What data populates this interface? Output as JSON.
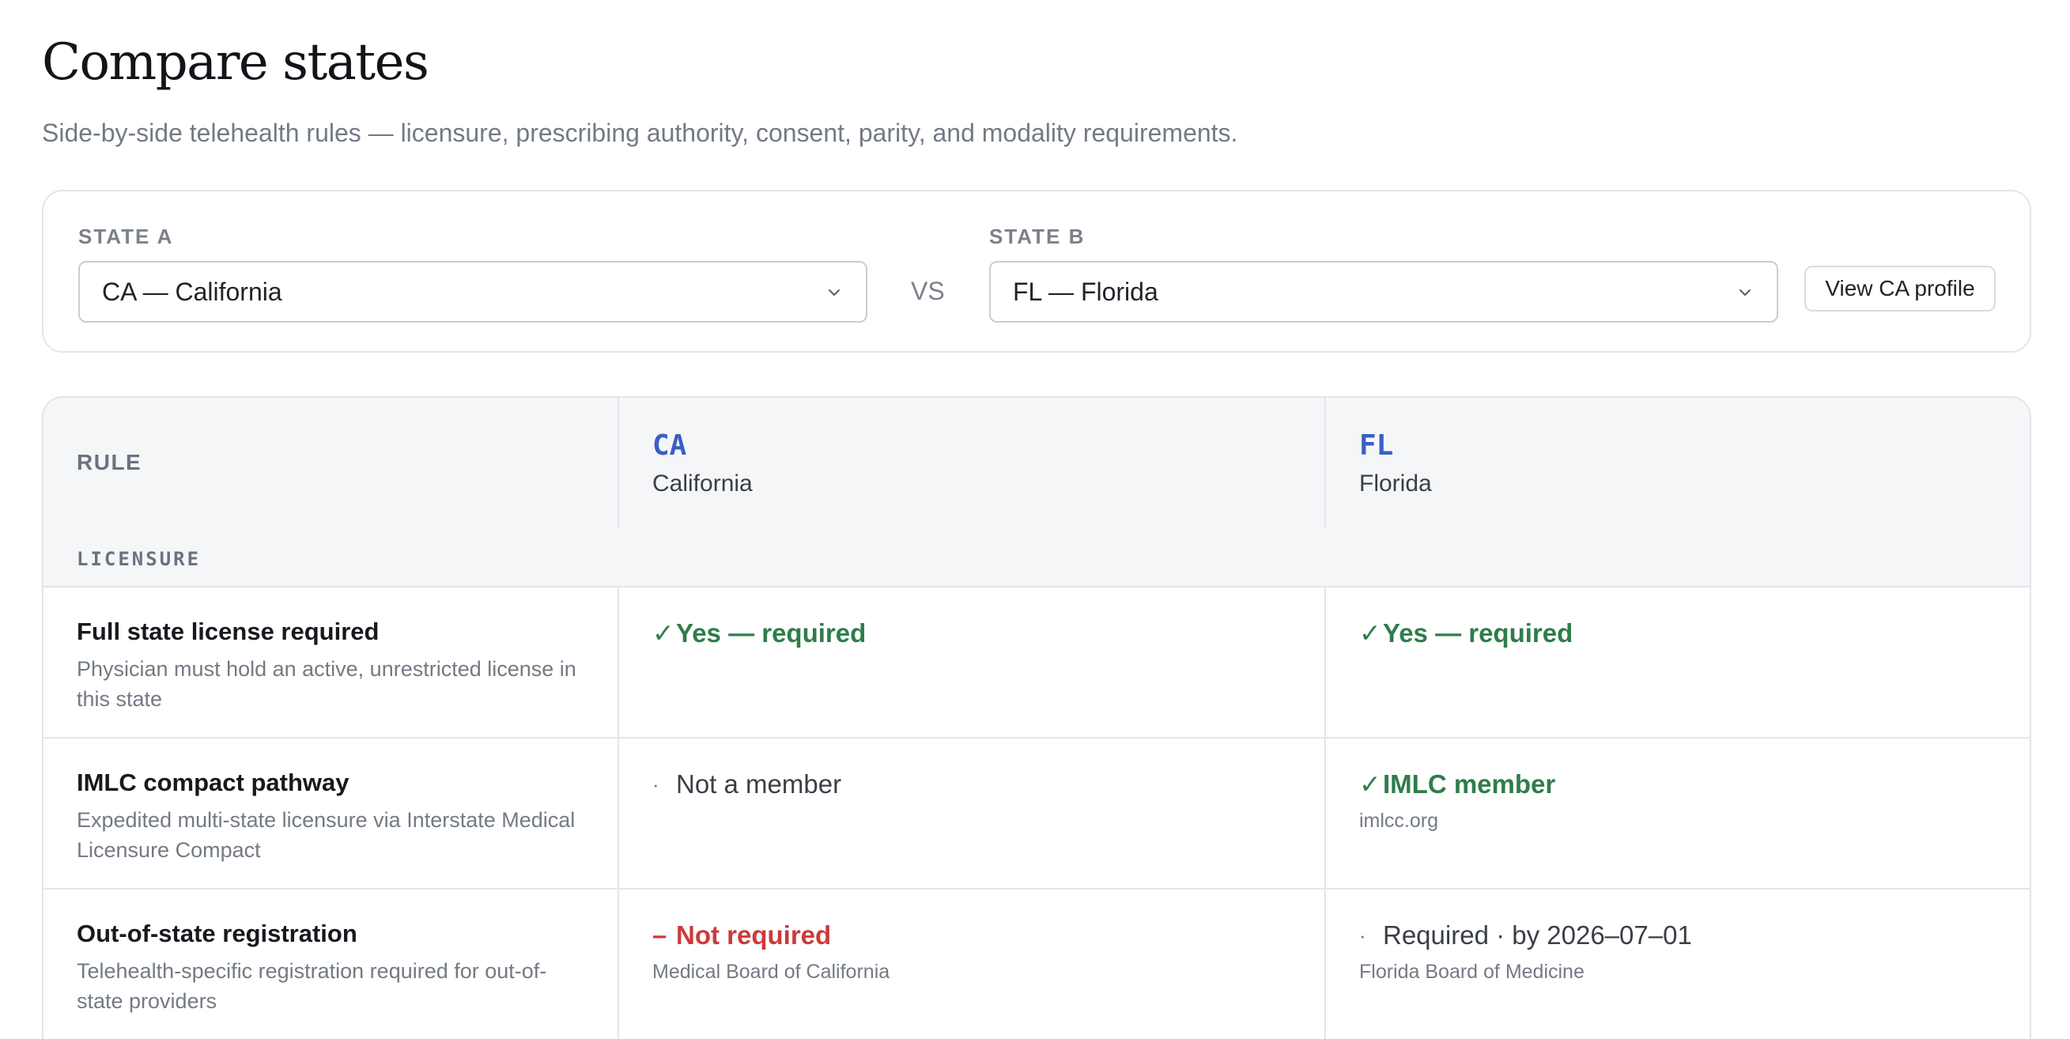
{
  "header": {
    "title": "Compare states",
    "subtitle": "Side-by-side telehealth rules — licensure, prescribing authority, consent, parity, and modality requirements."
  },
  "selector": {
    "state_a_label": "STATE A",
    "state_a_value": "CA — California",
    "vs": "VS",
    "state_b_label": "STATE B",
    "state_b_value": "FL — Florida",
    "profile_button": "View CA profile"
  },
  "table": {
    "rule_header": "RULE",
    "col_a": {
      "code": "CA",
      "name": "California"
    },
    "col_b": {
      "code": "FL",
      "name": "Florida"
    },
    "section": "LICENSURE",
    "rows": [
      {
        "title": "Full state license required",
        "desc": "Physician must hold an active, unrestricted license in this state",
        "a": {
          "mark": "✓",
          "text": "Yes — required",
          "note": ""
        },
        "b": {
          "mark": "✓",
          "text": "Yes — required",
          "note": ""
        }
      },
      {
        "title": "IMLC compact pathway",
        "desc": "Expedited multi-state licensure via Interstate Medical Licensure Compact",
        "a": {
          "mark": "·",
          "text": "Not a member",
          "note": ""
        },
        "b": {
          "mark": "✓",
          "text": "IMLC member",
          "note": "imlcc.org"
        }
      },
      {
        "title": "Out-of-state registration",
        "desc": "Telehealth-specific registration required for out-of-state providers",
        "a": {
          "mark": "–",
          "text": "Not required",
          "note": "Medical Board of California"
        },
        "b": {
          "mark": "·",
          "text": "Required · by 2026–07–01",
          "note": "Florida Board of Medicine"
        }
      }
    ]
  },
  "colors": {
    "accent": "#3c5ec4",
    "yes": "#2e7d4a",
    "no": "#cc3a3a",
    "muted": "#737a84"
  },
  "icons": {
    "select_chevron": "chevron-down-icon",
    "yes_mark": "check-icon",
    "no_mark": "dash-icon",
    "neutral_mark": "dot-icon"
  }
}
